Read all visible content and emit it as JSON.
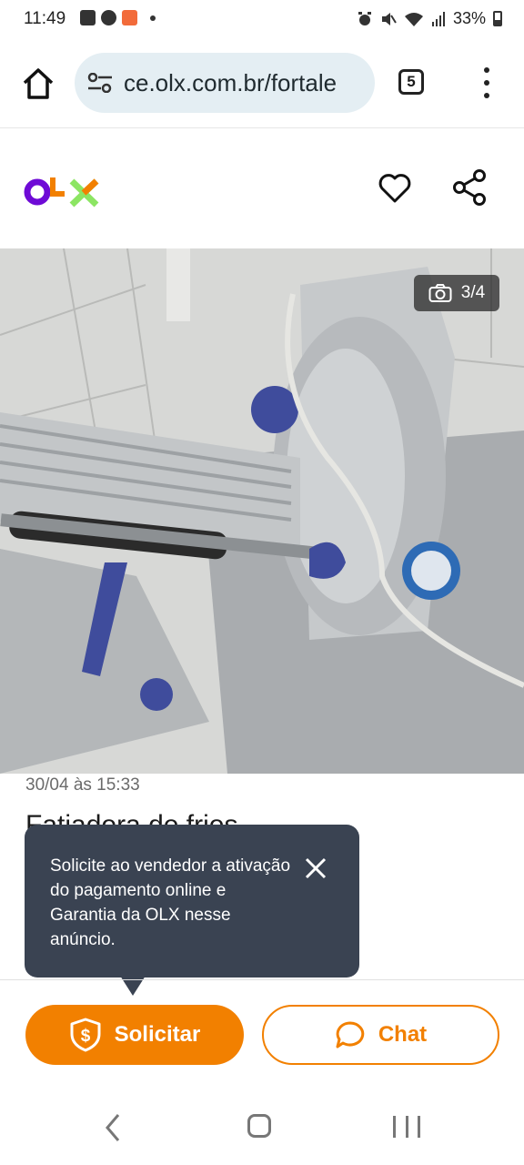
{
  "status_bar": {
    "time": "11:49",
    "battery": "33%",
    "icons": [
      "gallery-icon",
      "chat-bubble-icon",
      "app-notification-icon",
      "alarm-icon",
      "mute-icon",
      "wifi-icon",
      "signal-icon",
      "battery-icon"
    ]
  },
  "browser": {
    "url": "ce.olx.com.br/fortale",
    "tab_count": "5"
  },
  "header": {
    "logo_text": "OLX",
    "brand_colors": {
      "o": "#6e0ad6",
      "l": "#f28000",
      "x": "#8ce563"
    }
  },
  "gallery": {
    "counter": "3/4"
  },
  "listing": {
    "date": "30/04 às 15:33",
    "title": "Fatiadora de frios"
  },
  "tooltip": {
    "text": "Solicite ao vendedor a ativação do pagamento online e Garantia da OLX nesse anúncio."
  },
  "actions": {
    "solicitar_label": "Solicitar",
    "chat_label": "Chat",
    "accent_color": "#f28000"
  }
}
